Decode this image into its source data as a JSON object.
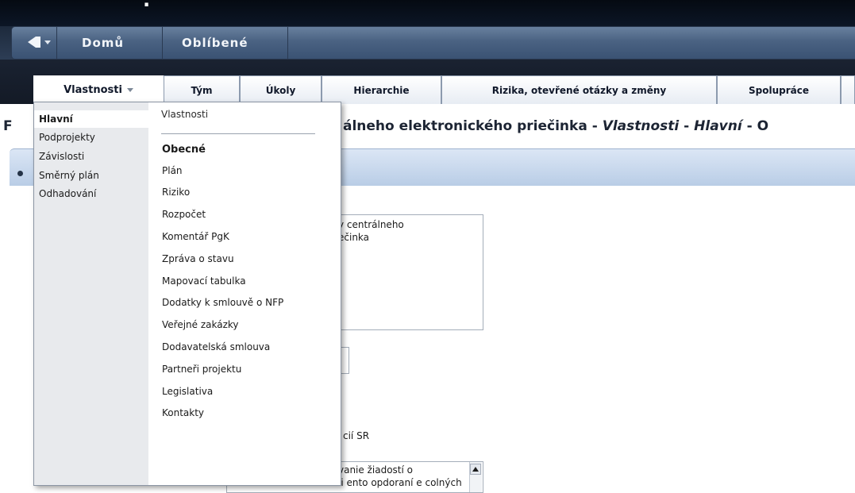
{
  "nav": {
    "home_label": "Domů",
    "favorites_label": "Oblíbené"
  },
  "tabs": [
    {
      "label": "Vlastnosti",
      "active": true
    },
    {
      "label": "Tým"
    },
    {
      "label": "Úkoly"
    },
    {
      "label": "Hierarchie"
    },
    {
      "label": "Rizika, otevřené otázky a změny"
    },
    {
      "label": "Spolupráce"
    }
  ],
  "page": {
    "title_prefix": "F",
    "title_visible": "álneho elektronického priečinka - ",
    "title_props": "Vlastnosti",
    "title_sep1": " - ",
    "title_main": "Hlavní",
    "title_sep2": " - O",
    "textarea1_lines": [
      "y centrálneho",
      "ečinka"
    ],
    "label_sr": "cií SR",
    "textarea2_lines": [
      "vanie žiadostí o",
      "ii ento  opdoraní e colných"
    ]
  },
  "dropdown": {
    "left_items": [
      {
        "label": "Hlavní",
        "selected": true
      },
      {
        "label": "Podprojekty"
      },
      {
        "label": "Závislosti"
      },
      {
        "label": "Směrný plán"
      },
      {
        "label": "Odhadování"
      }
    ],
    "header": "Vlastnosti",
    "items": [
      {
        "label": "Obecné",
        "bold": true
      },
      {
        "label": "Plán"
      },
      {
        "label": "Riziko"
      },
      {
        "label": "Rozpočet"
      },
      {
        "label": "Komentář PgK"
      },
      {
        "label": "Zpráva o stavu"
      },
      {
        "label": "Mapovací tabulka"
      },
      {
        "label": "Dodatky k smlouvě o NFP"
      },
      {
        "label": "Veřejné zakázky"
      },
      {
        "label": "Dodavatelská smlouva"
      },
      {
        "label": "Partneři projektu"
      },
      {
        "label": "Legislativa"
      },
      {
        "label": "Kontakty"
      }
    ]
  },
  "icons": {
    "back": "back-arrow-icon",
    "dropdown": "chevron-down-icon",
    "scroll_up": "scroll-up-arrow-icon"
  },
  "colors": {
    "navbar": "#4a6282",
    "tab_bg": "#ffffff",
    "header_bar": "#b9cde6"
  }
}
